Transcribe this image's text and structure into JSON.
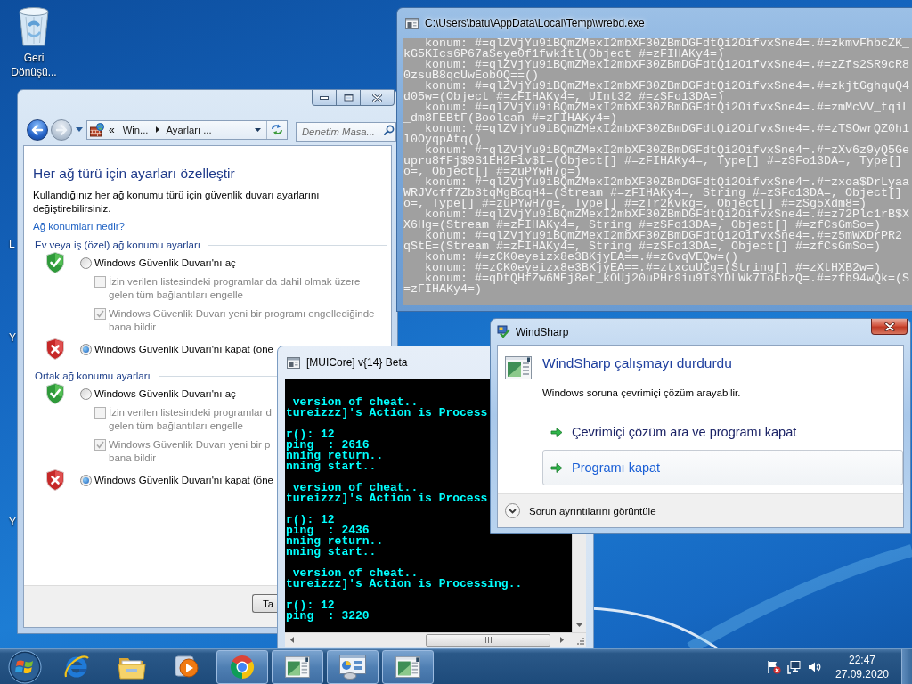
{
  "desktop": {
    "icons": [
      {
        "label": "Geri Dönüşü..."
      }
    ],
    "hidden_icon_labels": [
      "L",
      "Y",
      "Y"
    ]
  },
  "firewall_window": {
    "navigation": {
      "back_enabled": true,
      "forward_enabled": false
    },
    "address_bar": {
      "overflow": "«",
      "crumbs": [
        "Win...",
        "Ayarları ..."
      ]
    },
    "search": {
      "placeholder": "Denetim Masa..."
    },
    "heading": "Her ağ türü için ayarları özelleştir",
    "description": "Kullandığınız her ağ konumu türü için güvenlik duvarı ayarlarını değiştirebilirsiniz.",
    "link": "Ağ konumları nedir?",
    "sections": [
      {
        "title": "Ev veya iş (özel) ağ konumu ayarları",
        "options": [
          {
            "kind": "radio",
            "blocked": false,
            "label": "Windows Güvenlik Duvarı'nı aç",
            "selected": false
          },
          {
            "kind": "checkbox",
            "label_lines": [
              "İzin verilen listesindeki programlar da dahil olmak üzere",
              "gelen tüm bağlantıları engelle"
            ],
            "checked": false,
            "disabled": true
          },
          {
            "kind": "checkbox",
            "label_lines": [
              "Windows Güvenlik Duvarı yeni bir programı engellediğinde",
              "bana bildir"
            ],
            "checked": true,
            "disabled": true
          },
          {
            "kind": "radio",
            "blocked": true,
            "label": "Windows Güvenlik Duvarı'nı kapat (öne",
            "selected": true
          }
        ]
      },
      {
        "title": "Ortak ağ konumu ayarları",
        "options": [
          {
            "kind": "radio",
            "blocked": false,
            "label": "Windows Güvenlik Duvarı'nı aç",
            "selected": false
          },
          {
            "kind": "checkbox",
            "label_lines": [
              "İzin verilen listesindeki programlar d",
              "gelen tüm bağlantıları engelle"
            ],
            "checked": false,
            "disabled": true
          },
          {
            "kind": "checkbox",
            "label_lines": [
              "Windows Güvenlik Duvarı yeni bir p",
              "bana bildir"
            ],
            "checked": true,
            "disabled": true
          },
          {
            "kind": "radio",
            "blocked": true,
            "label": "Windows Güvenlik Duvarı'nı kapat (öne",
            "selected": true
          }
        ]
      }
    ],
    "footer_buttons": [
      "Ta"
    ]
  },
  "console_window": {
    "title": "C:\\Users\\batu\\AppData\\Local\\Temp\\wrebd.exe",
    "lines": [
      {
        "kind": "entry",
        "text": "konum: #=qlZVjYu9iBQmZMexI2mbXF30ZBmDGFdtQi2OifvxSne4=.#=zkmvFhbcZK_"
      },
      {
        "kind": "wrap",
        "text": "kG5KIcs6P67aSeye0f1fwk1tl(Object #=zFIHAKy4=)"
      },
      {
        "kind": "entry",
        "text": "konum: #=qlZVjYu9iBQmZMexI2mbXF30ZBmDGFdtQi2OifvxSne4=.#=zZfs2SR9cR8"
      },
      {
        "kind": "wrap",
        "text": "0zsuB8qcUwEobOQ==()"
      },
      {
        "kind": "entry",
        "text": "konum: #=qlZVjYu9iBQmZMexI2mbXF30ZBmDGFdtQi2OifvxSne4=.#=zkjtGghquQ4"
      },
      {
        "kind": "wrap",
        "text": "d05w=(Object #=zFIHAKy4=, UInt32 #=zSFo13DA=)"
      },
      {
        "kind": "entry",
        "text": "konum: #=qlZVjYu9iBQmZMexI2mbXF30ZBmDGFdtQi2OifvxSne4=.#=zmMcVV_tqiL"
      },
      {
        "kind": "wrap",
        "text": "_dm8FEBtF(Boolean #=zFIHAKy4=)"
      },
      {
        "kind": "entry",
        "text": "konum: #=qlZVjYu9iBQmZMexI2mbXF30ZBmDGFdtQi2OifvxSne4=.#=zTSOwrQZ0h1"
      },
      {
        "kind": "wrap",
        "text": "l0OyqpAtq()"
      },
      {
        "kind": "entry",
        "text": "konum: #=qlZVjYu9iBQmZMexI2mbXF30ZBmDGFdtQi2OifvxSne4=.#=zXv6z9yQ5Ge"
      },
      {
        "kind": "wrap",
        "text": "upru8fFj$9S1EH2Fiv$I=(Object[] #=zFIHAKy4=, Type[] #=zSFo13DA=, Type[]"
      },
      {
        "kind": "wrap",
        "text": "o=, Object[] #=zuPYwH7g=)"
      },
      {
        "kind": "entry",
        "text": "konum: #=qlZVjYu9iBQmZMexI2mbXF30ZBmDGFdtQi2OifvxSne4=.#=zxoa$DrLyaa"
      },
      {
        "kind": "wrap",
        "text": "WRJVcff7Zb3tqMgBcqH4=(Stream #=zFIHAKy4=, String #=zSFo13DA=, Object[]"
      },
      {
        "kind": "wrap",
        "text": "o=, Type[] #=zuPYwH7g=, Type[] #=zTr2Kvkg=, Object[] #=zSg5Xdm8=)"
      },
      {
        "kind": "entry",
        "text": "konum: #=qlZVjYu9iBQmZMexI2mbXF30ZBmDGFdtQi2OifvxSne4=.#=z72Plc1rB$X"
      },
      {
        "kind": "wrap",
        "text": "X6Hg=(Stream #=zFIHAKy4=, String #=zSFo13DA=, Object[] #=zfCsGmSo=)"
      },
      {
        "kind": "entry",
        "text": "konum: #=qlZVjYu9iBQmZMexI2mbXF30ZBmDGFdtQi2OifvxSne4=.#=z5mWXDrPR2_"
      },
      {
        "kind": "wrap",
        "text": "qStE=(Stream #=zFIHAKy4=, String #=zSFo13DA=, Object[] #=zfCsGmSo=)"
      },
      {
        "kind": "entry",
        "text": "konum: #=zCK0eyeizx8e3BKjyEA==.#=zGvqVEQw=()"
      },
      {
        "kind": "entry",
        "text": "konum: #=zCK0eyeizx8e3BKjyEA==.#=ztxcuUCg=(String[] #=zXtHXB2w=)"
      },
      {
        "kind": "entry",
        "text": "konum: #=qDtQHfZw6MEj8et_kOUj20uPHr9iu9TsYDLWk7ToFbzQ=.#=zfb94wQk=(S"
      },
      {
        "kind": "wrap",
        "text": "=zFIHAKy4=)"
      }
    ]
  },
  "muicore_window": {
    "title": "[MUICore] v{14} Beta",
    "blocks": [
      [
        " version of cheat..",
        "tureizzz]'s Action is Process"
      ],
      [
        "r(): 12",
        "ping  : 2616",
        "nning return..",
        "nning start.."
      ],
      [
        " version of cheat..",
        "tureizzz]'s Action is Process"
      ],
      [
        "r(): 12",
        "ping  : 2436",
        "nning return..",
        "nning start.."
      ],
      [
        " version of cheat..",
        "tureizzz]'s Action is Processing.."
      ],
      [
        "r(): 12",
        "ping  : 3220"
      ]
    ]
  },
  "error_dialog": {
    "title": "WindSharp",
    "heading": "WindSharp çalışmayı durdurdu",
    "description": "Windows soruna çevrimiçi çözüm arayabilir.",
    "actions": [
      {
        "label": "Çevrimiçi çözüm ara ve programı kapat",
        "selected": false
      },
      {
        "label": "Programı kapat",
        "selected": true
      }
    ],
    "details": {
      "label": "Sorun ayrıntılarını görüntüle",
      "expanded": false
    }
  },
  "taskbar": {
    "items": [
      {
        "kind": "web",
        "running": false
      },
      {
        "kind": "files",
        "running": false
      },
      {
        "kind": "media",
        "running": false
      },
      {
        "kind": "browser",
        "running": true
      },
      {
        "kind": "console",
        "running": true
      },
      {
        "kind": "panel",
        "running": true
      },
      {
        "kind": "console",
        "running": true
      }
    ],
    "clock": {
      "time": "22:47",
      "date": "27.09.2020"
    }
  }
}
